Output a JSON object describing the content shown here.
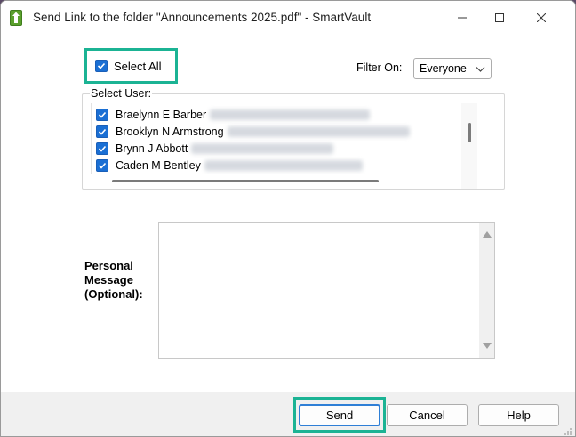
{
  "window": {
    "title": "Send Link to the folder \"Announcements 2025.pdf\" - SmartVault",
    "controls": {
      "minimize_icon": "minimize-icon",
      "maximize_icon": "maximize-icon",
      "close_icon": "close-icon"
    }
  },
  "select_all": {
    "label": "Select All",
    "checked": true
  },
  "filter": {
    "label": "Filter On:",
    "selected": "Everyone"
  },
  "user_list": {
    "label": "Select User:",
    "users": [
      {
        "name": "Braelynn E Barber",
        "checked": true
      },
      {
        "name": "Brooklyn N Armstrong",
        "checked": true
      },
      {
        "name": "Brynn J Abbott",
        "checked": true
      },
      {
        "name": "Caden M Bentley",
        "checked": true
      }
    ]
  },
  "message": {
    "label_line1": "Personal",
    "label_line2": "Message",
    "label_line3": "(Optional):",
    "value": ""
  },
  "buttons": {
    "send": "Send",
    "cancel": "Cancel",
    "help": "Help"
  },
  "colors": {
    "highlight": "#1bb394",
    "checkbox": "#1a6fd4",
    "app_icon": "#5aa02c"
  }
}
